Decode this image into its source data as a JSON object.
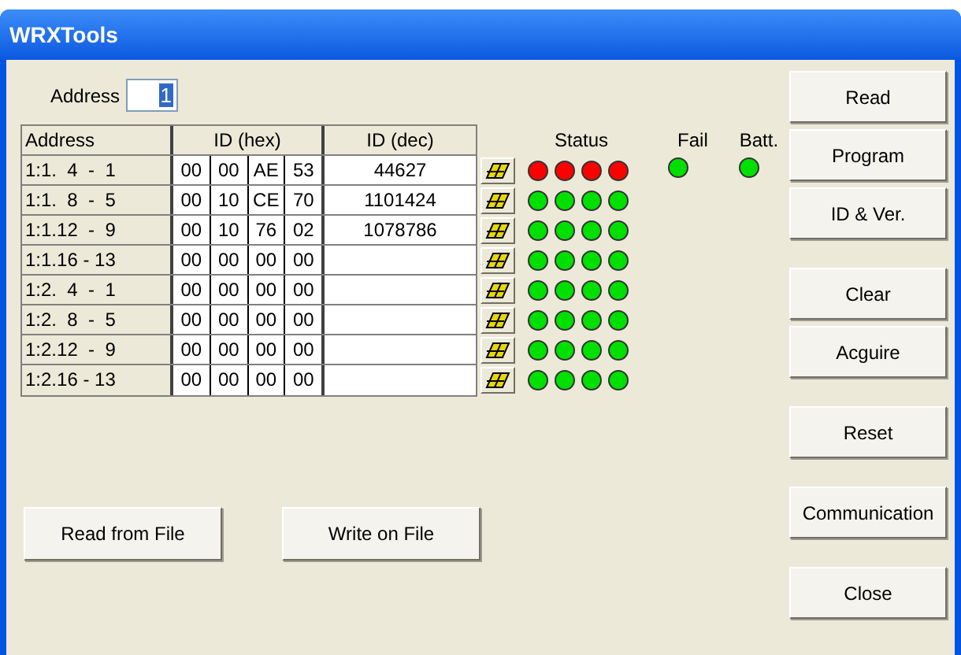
{
  "window": {
    "title": "WRXTools"
  },
  "address_field": {
    "label": "Address",
    "value": "1"
  },
  "table": {
    "columns": [
      "Address",
      "ID (hex)",
      "ID (dec)"
    ],
    "rows": [
      {
        "address": "1:1.  4  -  1",
        "hex": [
          "00",
          "00",
          "AE",
          "53"
        ],
        "dec": "44627"
      },
      {
        "address": "1:1.  8  -  5",
        "hex": [
          "00",
          "10",
          "CE",
          "70"
        ],
        "dec": "1101424"
      },
      {
        "address": "1:1.12  -  9",
        "hex": [
          "00",
          "10",
          "76",
          "02"
        ],
        "dec": "1078786"
      },
      {
        "address": "1:1.16 - 13",
        "hex": [
          "00",
          "00",
          "00",
          "00"
        ],
        "dec": ""
      },
      {
        "address": "1:2.  4  -  1",
        "hex": [
          "00",
          "00",
          "00",
          "00"
        ],
        "dec": ""
      },
      {
        "address": "1:2.  8  -  5",
        "hex": [
          "00",
          "00",
          "00",
          "00"
        ],
        "dec": ""
      },
      {
        "address": "1:2.12  -  9",
        "hex": [
          "00",
          "00",
          "00",
          "00"
        ],
        "dec": ""
      },
      {
        "address": "1:2.16 - 13",
        "hex": [
          "00",
          "00",
          "00",
          "00"
        ],
        "dec": ""
      }
    ]
  },
  "status": {
    "headers": [
      "Status",
      "Fail",
      "Batt."
    ],
    "rows": [
      {
        "leds": [
          {
            "color": "#ff0000"
          },
          {
            "color": "#ff0000"
          },
          {
            "color": "#ff0000"
          },
          {
            "color": "#ff0000"
          }
        ],
        "fail": {
          "color": "#00e000"
        },
        "batt": {
          "color": "#00e000"
        }
      },
      {
        "leds": [
          {
            "color": "#00e000"
          },
          {
            "color": "#00e000"
          },
          {
            "color": "#00e000"
          },
          {
            "color": "#00e000"
          }
        ]
      },
      {
        "leds": [
          {
            "color": "#00e000"
          },
          {
            "color": "#00e000"
          },
          {
            "color": "#00e000"
          },
          {
            "color": "#00e000"
          }
        ]
      },
      {
        "leds": [
          {
            "color": "#00e000"
          },
          {
            "color": "#00e000"
          },
          {
            "color": "#00e000"
          },
          {
            "color": "#00e000"
          }
        ]
      },
      {
        "leds": [
          {
            "color": "#00e000"
          },
          {
            "color": "#00e000"
          },
          {
            "color": "#00e000"
          },
          {
            "color": "#00e000"
          }
        ]
      },
      {
        "leds": [
          {
            "color": "#00e000"
          },
          {
            "color": "#00e000"
          },
          {
            "color": "#00e000"
          },
          {
            "color": "#00e000"
          }
        ]
      },
      {
        "leds": [
          {
            "color": "#00e000"
          },
          {
            "color": "#00e000"
          },
          {
            "color": "#00e000"
          },
          {
            "color": "#00e000"
          }
        ]
      },
      {
        "leds": [
          {
            "color": "#00e000"
          },
          {
            "color": "#00e000"
          },
          {
            "color": "#00e000"
          },
          {
            "color": "#00e000"
          }
        ]
      }
    ]
  },
  "file_buttons": [
    "Read from File",
    "Write on File"
  ],
  "side_buttons": [
    [
      "Read",
      "Program",
      "ID & Ver."
    ],
    [
      "Clear",
      "Acguire"
    ],
    [
      "Reset"
    ],
    [
      "Communication"
    ],
    [
      "Close"
    ]
  ]
}
